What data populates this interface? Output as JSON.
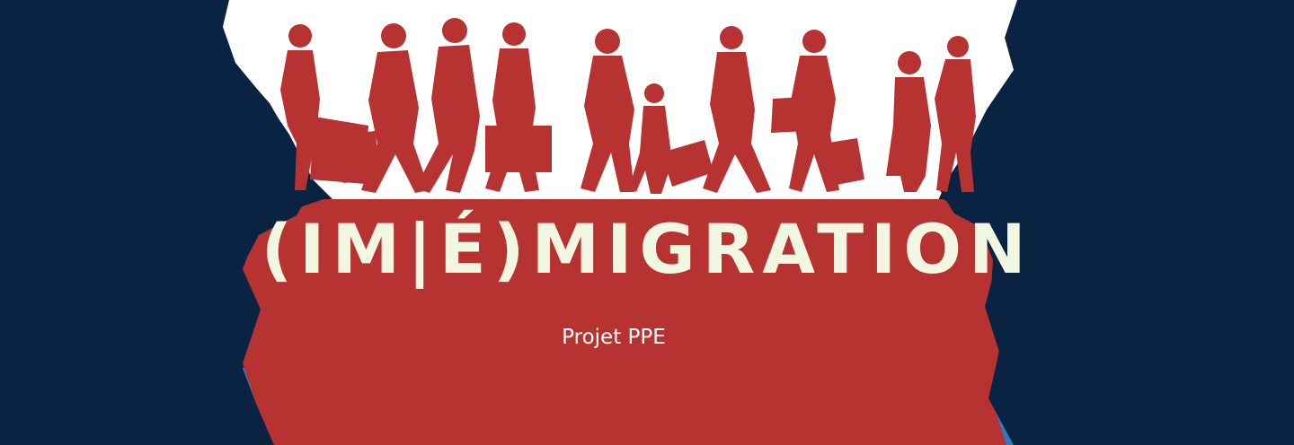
{
  "banner": {
    "title": "(IM|É)MIGRATION",
    "subtitle": "Projet PPE",
    "illustration": "walking-crowd-silhouettes-between-facing-heads"
  },
  "colors": {
    "navy": "#0a2342",
    "red": "#b73331",
    "white": "#ffffff",
    "blue": "#2e7cc4",
    "title_text": "#f2f7e1",
    "subtitle_text": "#ffffff"
  }
}
